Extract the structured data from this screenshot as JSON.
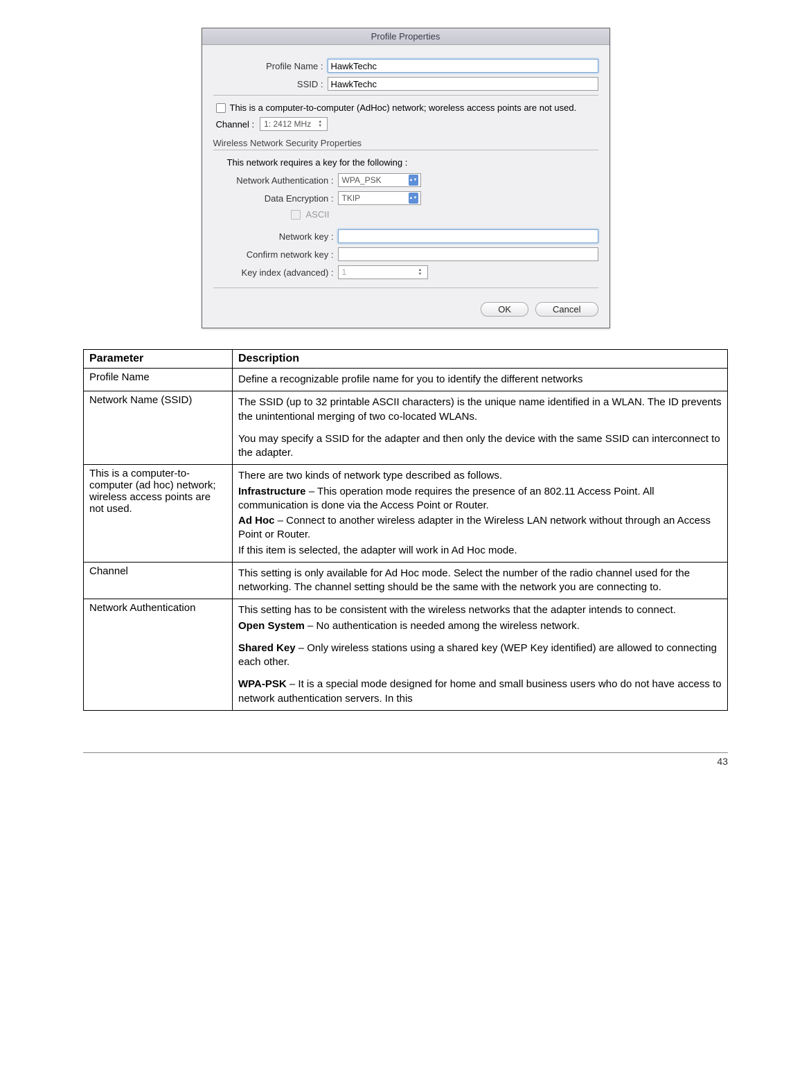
{
  "dialog": {
    "title": "Profile Properties",
    "profile_name_label": "Profile Name :",
    "profile_name_value": "HawkTechc",
    "ssid_label": "SSID :",
    "ssid_value": "HawkTechc",
    "adhoc_label": "This is a computer-to-computer (AdHoc) network; woreless access points are not used.",
    "channel_label": "Channel :",
    "channel_value": "1: 2412 MHz",
    "security_section": "Wireless Network Security Properties",
    "requires_key": "This network requires a key for the following :",
    "auth_label": "Network Authentication :",
    "auth_value": "WPA_PSK",
    "enc_label": "Data Encryption :",
    "enc_value": "TKIP",
    "ascii_label": "ASCII",
    "netkey_label": "Network key :",
    "confirm_key_label": "Confirm network key :",
    "keyidx_label": "Key index (advanced) :",
    "keyidx_value": "1",
    "ok_label": "OK",
    "cancel_label": "Cancel"
  },
  "table": {
    "header_param": "Parameter",
    "header_desc": "Description",
    "rows": [
      {
        "param": "Profile Name",
        "desc": [
          "Define a recognizable profile name for you to identify the different networks"
        ]
      },
      {
        "param": "Network Name (SSID)",
        "desc": [
          "The SSID (up to 32 printable ASCII characters) is the unique name identified in a WLAN. The ID prevents the unintentional merging of two co-located WLANs.",
          "You may specify a SSID for the adapter and then only the device with the same SSID can interconnect to the adapter."
        ]
      },
      {
        "param": "This is a computer-to-computer (ad hoc) network; wireless access points are not used.",
        "desc_parts": [
          {
            "text": "There are two kinds of network type described as follows."
          },
          {
            "bold": "Infrastructure",
            "text": " – This operation mode requires the presence of an 802.11 Access Point. All communication is done via the Access Point or Router."
          },
          {
            "bold": "Ad Hoc",
            "text": " – Connect to another wireless adapter in the Wireless LAN network without through an Access Point or Router."
          },
          {
            "text": "If this item is selected, the adapter will work in Ad Hoc mode."
          }
        ]
      },
      {
        "param": "Channel",
        "desc": [
          "This setting is only available for Ad Hoc mode. Select the number of the radio channel used for the networking. The channel setting should be the same with the network you are connecting to."
        ]
      },
      {
        "param": "Network Authentication",
        "desc_parts": [
          {
            "text": "This setting has to be consistent with the wireless networks that the adapter intends to connect."
          },
          {
            "bold": "Open System",
            "text": " – No authentication is needed among the wireless network."
          },
          {
            "bold": "Shared Key",
            "text": " – Only wireless stations using a shared key (WEP Key identified) are allowed to connecting each other.",
            "gap": true
          },
          {
            "bold": "WPA-PSK",
            "text": " – It is a special mode designed for home and small business users who do not have access to network authentication servers. In this",
            "gap": true
          }
        ]
      }
    ]
  },
  "page_number": "43"
}
